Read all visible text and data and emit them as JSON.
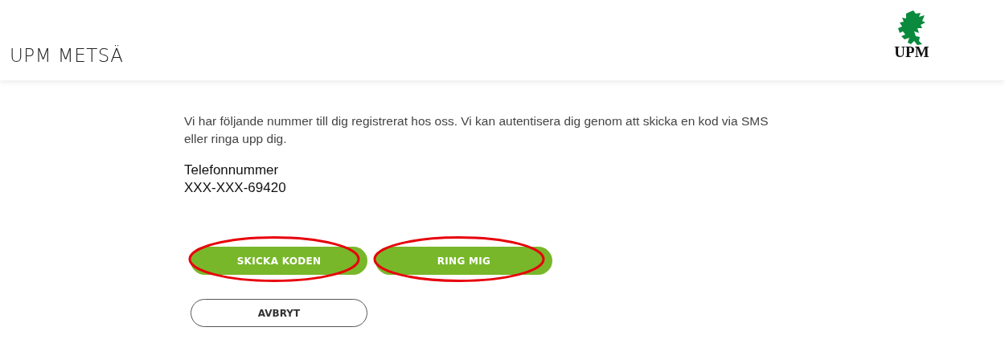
{
  "header": {
    "title": "UPM METSÄ",
    "logo_text": "UPM"
  },
  "intro": "Vi har följande nummer till dig registrerat hos oss. Vi kan autentisera dig genom att skicka en kod via SMS eller ringa upp dig.",
  "phone": {
    "label": "Telefonnummer",
    "value": "XXX-XXX-69420"
  },
  "actions": [
    {
      "label": "SKICKA KODEN",
      "kind": "primary",
      "circled": true
    },
    {
      "label": "RING MIG",
      "kind": "primary",
      "circled": true
    }
  ],
  "cancel": {
    "label": "AVBRYT"
  }
}
